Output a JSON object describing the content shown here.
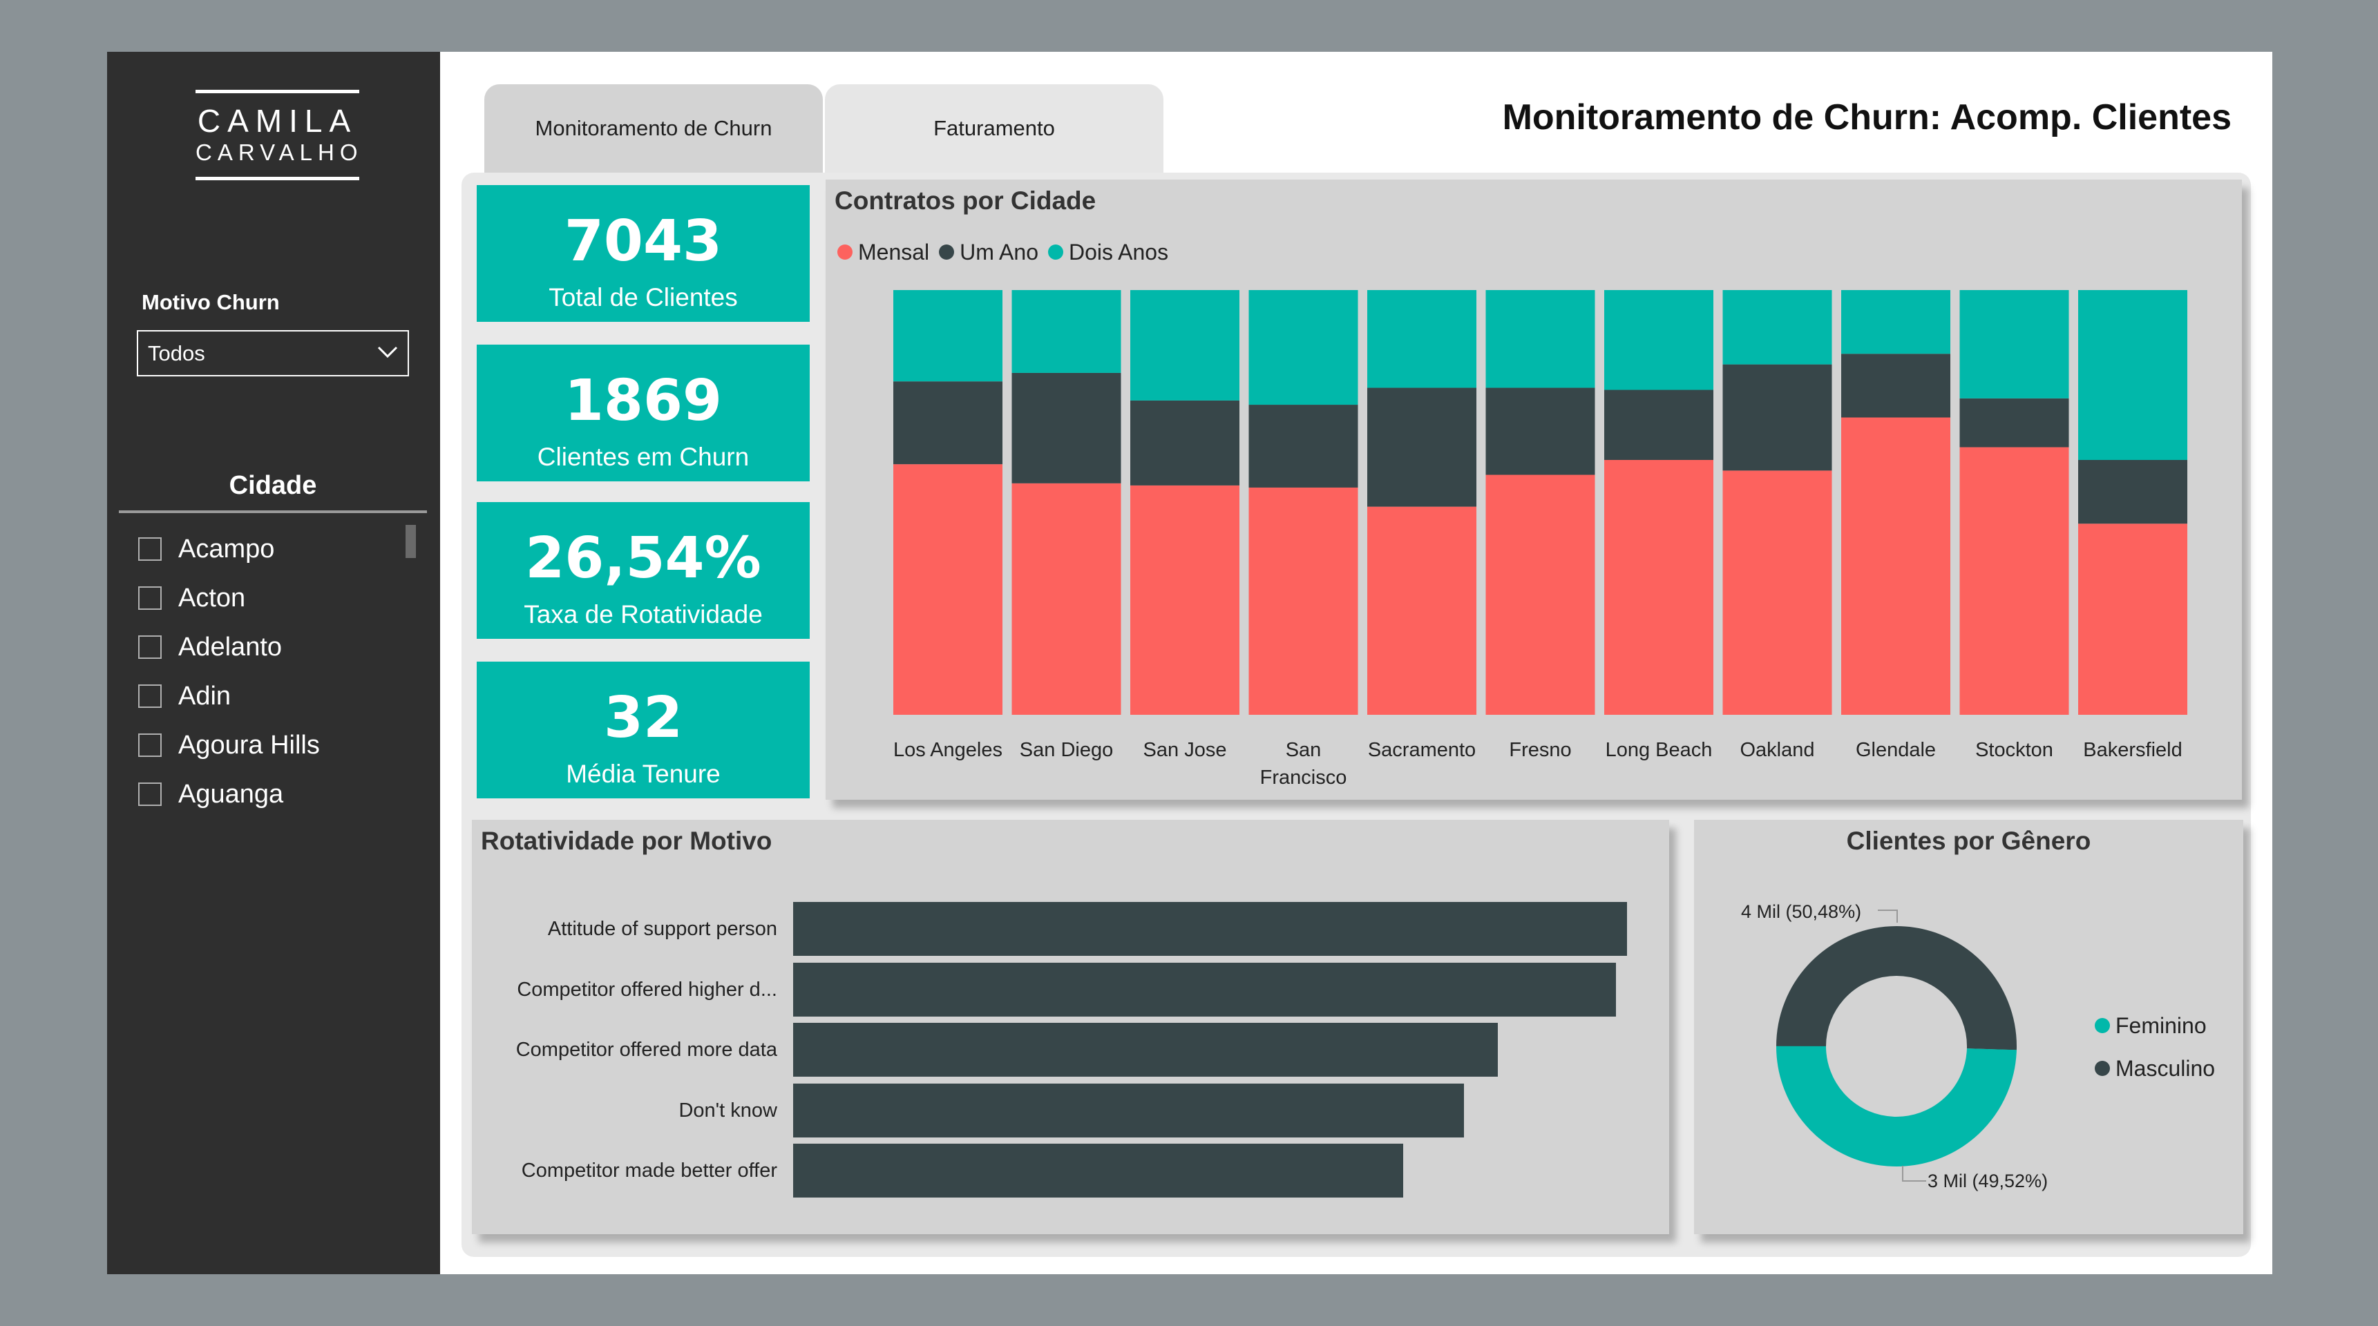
{
  "brand": {
    "line1": "CAMILA",
    "line2": "CARVALHO"
  },
  "filter": {
    "label": "Motivo Churn",
    "value": "Todos"
  },
  "cities_filter": {
    "title": "Cidade",
    "items": [
      "Acampo",
      "Acton",
      "Adelanto",
      "Adin",
      "Agoura Hills",
      "Aguanga"
    ]
  },
  "tabs": [
    "Monitoramento de Churn",
    "Faturamento"
  ],
  "page_title": "Monitoramento de Churn: Acomp. Clientes",
  "kpis": [
    {
      "value": "7043",
      "label": "Total de Clientes"
    },
    {
      "value": "1869",
      "label": "Clientes em Churn"
    },
    {
      "value": "26,54%",
      "label": "Taxa de Rotatividade"
    },
    {
      "value": "32",
      "label": "Média Tenure"
    }
  ],
  "colors": {
    "mensal": "#fd625e",
    "um_ano": "#374649",
    "dois_anos": "#01b8aa"
  },
  "chart_data": [
    {
      "type": "bar",
      "stacked": "100%",
      "title": "Contratos por Cidade",
      "categories": [
        "Los Angeles",
        "San Diego",
        "San Jose",
        "San Francisco",
        "Sacramento",
        "Fresno",
        "Long Beach",
        "Oakland",
        "Glendale",
        "Stockton",
        "Bakersfield"
      ],
      "series": [
        {
          "name": "Mensal",
          "values": [
            59,
            54.5,
            54,
            53.5,
            49,
            56.5,
            60,
            57.5,
            70,
            63,
            45
          ]
        },
        {
          "name": "Um Ano",
          "values": [
            19.5,
            26,
            20,
            19.5,
            28,
            20.5,
            16.5,
            25,
            15,
            11.5,
            15
          ]
        },
        {
          "name": "Dois Anos",
          "values": [
            21.5,
            19.5,
            26,
            27,
            23,
            23,
            23.5,
            17.5,
            15,
            25.5,
            40
          ]
        }
      ],
      "ylim": [
        0,
        100
      ],
      "legend": "top-left"
    },
    {
      "type": "bar",
      "orientation": "horizontal",
      "title": "Rotatividade por Motivo",
      "categories": [
        "Attitude of support person",
        "Competitor offered higher d...",
        "Competitor offered more data",
        "Don't know",
        "Competitor made better offer"
      ],
      "values": [
        220,
        217,
        186,
        177,
        161
      ]
    },
    {
      "type": "pie",
      "donut": true,
      "title": "Clientes por Gênero",
      "slices": [
        {
          "name": "Masculino",
          "value": 50.48,
          "label": "4 Mil (50,48%)"
        },
        {
          "name": "Feminino",
          "value": 49.52,
          "label": "3 Mil (49,52%)"
        }
      ],
      "legend": "right"
    }
  ]
}
